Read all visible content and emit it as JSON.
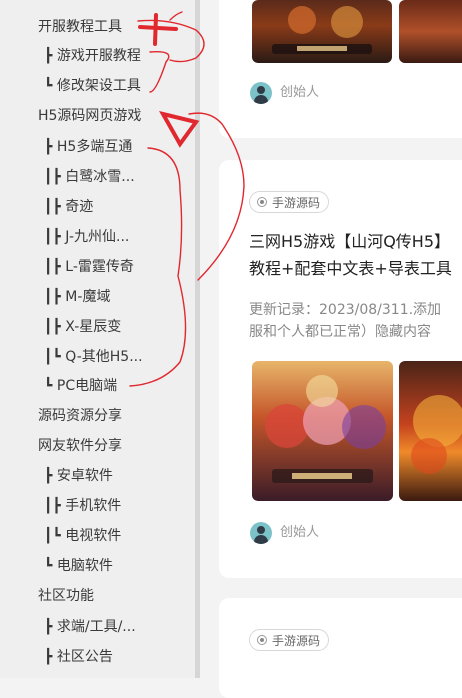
{
  "sidebar": {
    "items": [
      {
        "label": "开服教程工具"
      },
      {
        "label": "┣ 游戏开服教程"
      },
      {
        "label": "┗ 修改架设工具"
      },
      {
        "label": "H5源码网页游戏"
      },
      {
        "label": "┣ H5多端互通"
      },
      {
        "label": "┃┣ 白鹭冰雪..."
      },
      {
        "label": "┃┣ 奇迹"
      },
      {
        "label": "┃┣ J-九州仙..."
      },
      {
        "label": "┃┣ L-雷霆传奇"
      },
      {
        "label": "┃┣ M-魔域"
      },
      {
        "label": "┃┣ X-星辰变"
      },
      {
        "label": "┃┗ Q-其他H5..."
      },
      {
        "label": "┗ PC电脑端"
      },
      {
        "label": "源码资源分享"
      },
      {
        "label": "网友软件分享"
      },
      {
        "label": "┣ 安卓软件"
      },
      {
        "label": "┃┣ 手机软件"
      },
      {
        "label": "┃┗ 电视软件"
      },
      {
        "label": "┗ 电脑软件"
      },
      {
        "label": "社区功能"
      },
      {
        "label": "┣ 求端/工具/..."
      },
      {
        "label": "┣ 社区公告"
      }
    ]
  },
  "posts": [
    {
      "author": "创始人"
    },
    {
      "tag": "手游源码",
      "title_line1": "三网H5游戏【山河Q传H5】",
      "title_line2": "教程+配套中文表+导表工具",
      "desc_line1": "更新记录：2023/08/311.添加",
      "desc_line2": "服和个人都已正常）隐藏内容",
      "author": "创始人"
    },
    {
      "tag": "手游源码"
    }
  ],
  "colors": {
    "annotation": "#e0282e",
    "sidebar_bg": "#efefef",
    "card_bg": "#ffffff"
  }
}
